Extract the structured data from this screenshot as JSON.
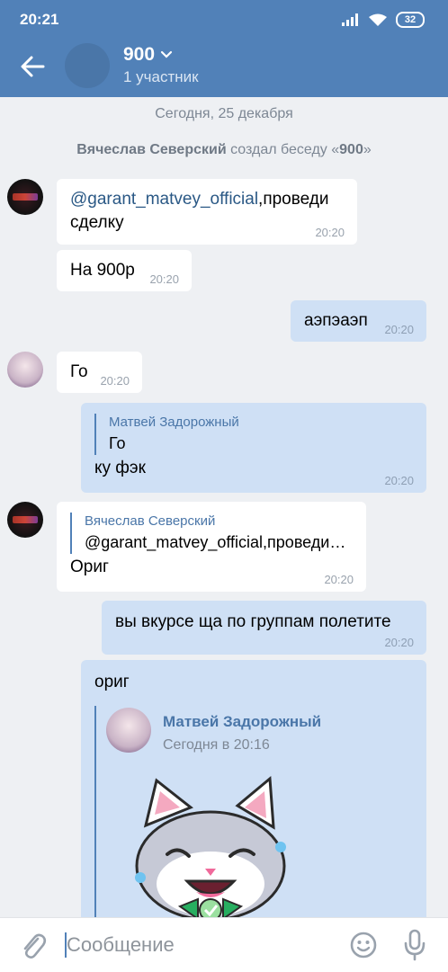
{
  "status": {
    "time": "20:21",
    "battery": "32"
  },
  "header": {
    "title": "900",
    "subtitle": "1 участник"
  },
  "chat": {
    "date": "Сегодня, 25 декабря",
    "system": {
      "author": "Вячеслав Северский",
      "action": "создал беседу «",
      "name": "900",
      "end": "»"
    },
    "messages": {
      "m1": {
        "mention": "@garant_matvey_official",
        "text_rest": ",проведи",
        "text_line2": "сделку",
        "time": "20:20"
      },
      "m2": {
        "text": "На 900р",
        "time": "20:20"
      },
      "m3": {
        "text": "аэпэаэп",
        "time": "20:20"
      },
      "m4": {
        "text": "Го",
        "time": "20:20"
      },
      "m5": {
        "reply_name": "Матвей Задорожный",
        "reply_text": "Го",
        "text": "ку фэк",
        "time": "20:20"
      },
      "m6": {
        "reply_name": "Вячеслав Северский",
        "reply_text": "@garant_matvey_official,проведи…",
        "text": "Ориг",
        "time": "20:20"
      },
      "m7": {
        "text": "вы вкурсе ща по группам полетите",
        "time": "20:20"
      },
      "m8": {
        "text": "ориг",
        "fwd_name": "Матвей Задорожный",
        "fwd_time": "Сегодня в 20:16"
      }
    }
  },
  "input": {
    "placeholder": "Сообщение"
  }
}
